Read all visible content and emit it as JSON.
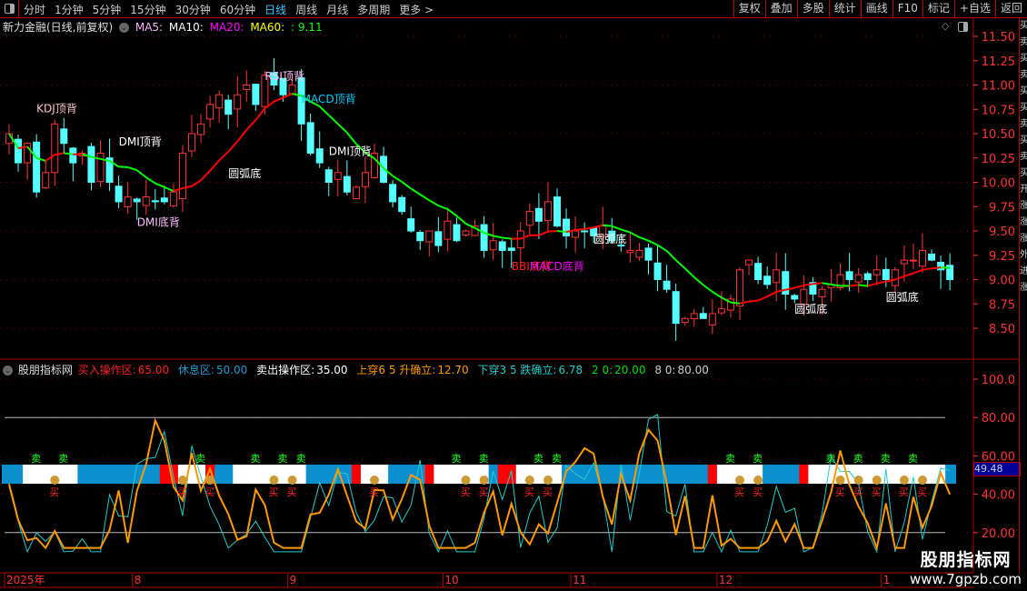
{
  "toolbar": {
    "periods": [
      "分时",
      "1分钟",
      "5分钟",
      "15分钟",
      "30分钟",
      "60分钟",
      "日线",
      "周线",
      "月线",
      "多周期",
      "更多 >"
    ],
    "active": "日线",
    "buttons": [
      "复权",
      "叠加",
      "多股",
      "统计",
      "画线",
      "F10",
      "标记",
      "+自选",
      "返回"
    ]
  },
  "main": {
    "stock": "新力金融(日线,前复权)",
    "ma5": "MA5:",
    "ma10": "MA10:",
    "ma20": "MA20:",
    "ma60": "MA60:",
    "value": ": 9.11",
    "price_axis": [
      "11.50",
      "11.25",
      "11.00",
      "10.75",
      "10.50",
      "10.25",
      "10.00",
      "9.75",
      "9.50",
      "9.25",
      "9.00",
      "8.75",
      "8.50"
    ],
    "annotations": [
      {
        "t": "KDJ顶背",
        "i": 3,
        "p": 10.72,
        "c": "#ffc0cb"
      },
      {
        "t": "DMI顶背",
        "i": 12,
        "p": 10.38,
        "c": "#fff"
      },
      {
        "t": "DMI底背",
        "i": 14,
        "p": 9.55,
        "c": "#ffc0ff"
      },
      {
        "t": "圆弧底",
        "i": 24,
        "p": 10.05,
        "c": "#fff"
      },
      {
        "t": "RSI顶背",
        "i": 28,
        "p": 11.05,
        "c": "#ffc0ff"
      },
      {
        "t": "MACD顶背",
        "i": 32,
        "p": 10.82,
        "c": "#0cf"
      },
      {
        "t": "DMI顶背",
        "i": 35,
        "p": 10.28,
        "c": "#fff"
      },
      {
        "t": "BBI底背",
        "i": 55,
        "p": 9.1,
        "c": "#f22"
      },
      {
        "t": "MACD底背",
        "i": 57,
        "p": 9.1,
        "c": "#f0f"
      },
      {
        "t": "圆弧底",
        "i": 64,
        "p": 9.38,
        "c": "#fff"
      },
      {
        "t": "圆弧底",
        "i": 86,
        "p": 8.66,
        "c": "#fff"
      },
      {
        "t": "圆弧底",
        "i": 96,
        "p": 8.78,
        "c": "#fff"
      }
    ],
    "closes": [
      10.5,
      10.2,
      10.4,
      9.9,
      10.1,
      10.6,
      10.4,
      10.2,
      10.3,
      10.0,
      10.3,
      10.0,
      9.8,
      9.85,
      9.8,
      9.85,
      9.8,
      9.8,
      9.9,
      10.3,
      10.5,
      10.6,
      10.8,
      10.9,
      10.7,
      10.9,
      11.0,
      10.8,
      11.1,
      11.0,
      10.9,
      11.0,
      10.6,
      10.3,
      10.2,
      10.0,
      10.1,
      9.9,
      9.95,
      10.1,
      10.3,
      10.0,
      9.8,
      9.7,
      9.5,
      9.4,
      9.5,
      9.35,
      9.6,
      9.4,
      9.5,
      9.55,
      9.3,
      9.4,
      9.3,
      9.3,
      9.5,
      9.7,
      9.6,
      9.8,
      9.55,
      9.45,
      9.5,
      9.5,
      9.45,
      9.55,
      9.4,
      9.35,
      9.3,
      9.3,
      9.2,
      9.0,
      8.9,
      8.55,
      8.6,
      8.65,
      8.6,
      8.65,
      8.7,
      8.8,
      9.1,
      9.2,
      9.0,
      8.95,
      9.1,
      8.85,
      8.8,
      8.9,
      8.85,
      8.9,
      8.95,
      9.05,
      9.0,
      9.05,
      9.0,
      9.1,
      9.0,
      9.1,
      9.2,
      9.2,
      9.3,
      9.2,
      9.1,
      9.0
    ]
  },
  "indicator": {
    "name": "股朋指标网",
    "buy_label": "买入操作区:",
    "buy": "65.00",
    "rest_label": "休息区:",
    "rest": "50.00",
    "sell_label": "卖出操作区:",
    "sell": "35.00",
    "up_label": "上穿6 5 升确立:",
    "up": "12.70",
    "down_label": "下穿3 5 跌确立:",
    "down": "6.78",
    "l20_label": "2 0:",
    "l20": "20.00",
    "l80_label": "8 0:",
    "l80": "80.00",
    "axis": [
      "100.0",
      "80.00",
      "60.00",
      "40.00",
      "20.00"
    ],
    "current": "49.48",
    "sell_glyph": "卖",
    "buy_glyph": "买"
  },
  "dates": [
    {
      "t": "2025年",
      "i": 0
    },
    {
      "t": "8",
      "i": 14
    },
    {
      "t": "9",
      "i": 31
    },
    {
      "t": "10",
      "i": 48
    },
    {
      "t": "11",
      "i": 62
    },
    {
      "t": "12",
      "i": 78
    },
    {
      "t": "1",
      "i": 96
    }
  ],
  "strip": "买卖买卖买买卖买卖买开涨涨涨外进涨",
  "watermark": {
    "name": "股朋指标网",
    "url": "www.7gpzb.com"
  },
  "colors": {
    "up": "#ff3333",
    "down": "#54ffff",
    "axis": "#ff3333",
    "frame": "#b00000"
  }
}
